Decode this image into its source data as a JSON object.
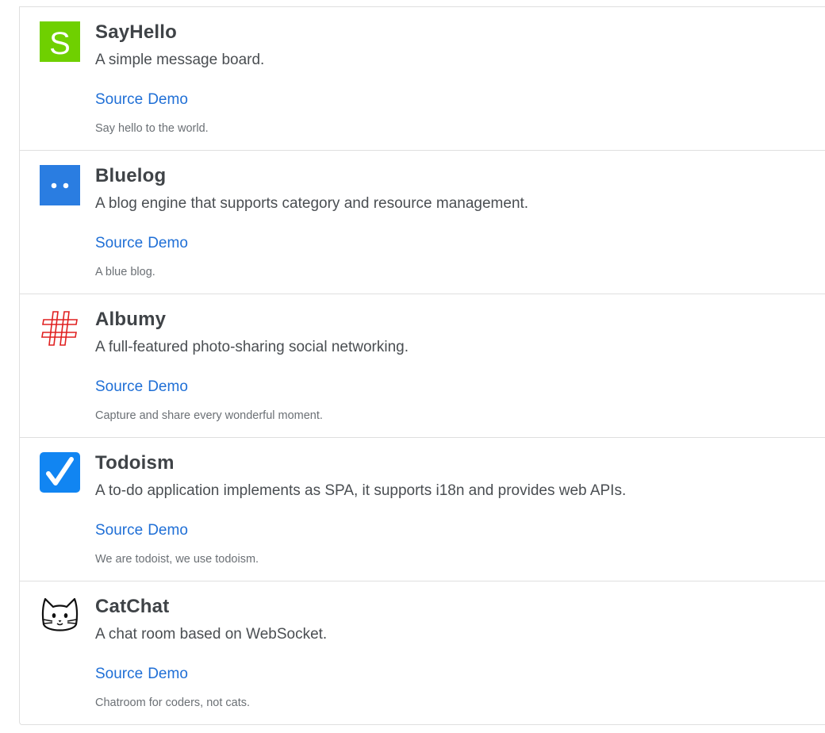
{
  "projects": [
    {
      "name": "SayHello",
      "description": "A simple message board.",
      "source_label": "Source",
      "demo_label": "Demo",
      "tagline": "Say hello to the world.",
      "logo_letter": "S",
      "logo_icon": "sayhello-logo-icon",
      "accent": "#6fd000"
    },
    {
      "name": "Bluelog",
      "description": "A blog engine that supports category and resource management.",
      "source_label": "Source",
      "demo_label": "Demo",
      "tagline": "A blue blog.",
      "logo_icon": "bluelog-logo-icon",
      "accent": "#2a7de1"
    },
    {
      "name": "Albumy",
      "description": "A full-featured photo-sharing social networking.",
      "source_label": "Source",
      "demo_label": "Demo",
      "tagline": "Capture and share every wonderful moment.",
      "logo_icon": "hash-logo-icon",
      "accent": "#e02020"
    },
    {
      "name": "Todoism",
      "description": "A to-do application implements as SPA, it supports i18n and provides web APIs.",
      "source_label": "Source",
      "demo_label": "Demo",
      "tagline": "We are todoist, we use todoism.",
      "logo_icon": "checkmark-logo-icon",
      "accent": "#1185f2"
    },
    {
      "name": "CatChat",
      "description": "A chat room based on WebSocket.",
      "source_label": "Source",
      "demo_label": "Demo",
      "tagline": "Chatroom for coders, not cats.",
      "logo_icon": "cat-logo-icon",
      "accent": "#111111"
    }
  ],
  "colors": {
    "link": "#1f6fd6",
    "border": "#dfdfdf",
    "title": "#3f4347",
    "muted": "#6b7075"
  }
}
